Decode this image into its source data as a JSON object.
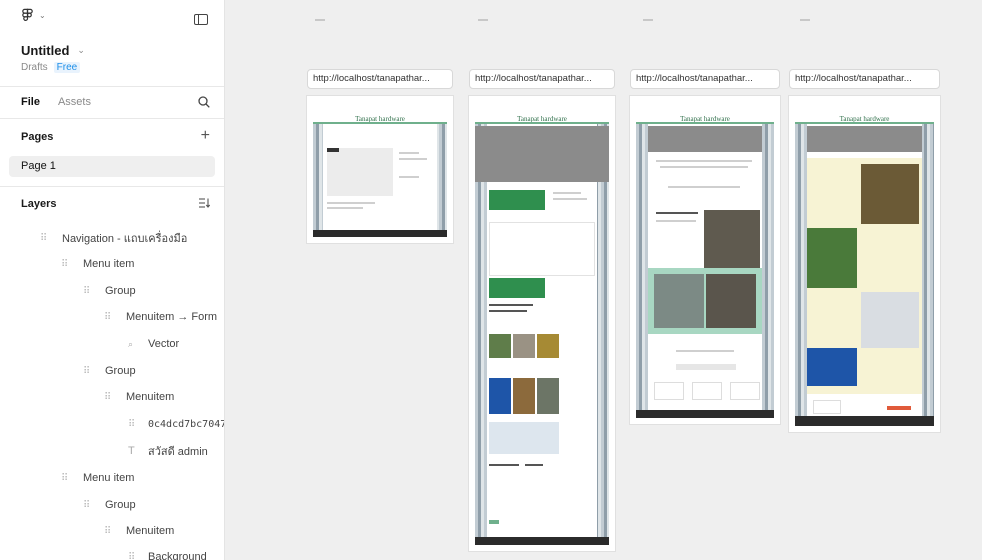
{
  "sidebar": {
    "file_name": "Untitled",
    "location": "Drafts",
    "plan_badge": "Free",
    "tabs": {
      "file": "File",
      "assets": "Assets"
    },
    "pages_title": "Pages",
    "pages": [
      "Page 1"
    ],
    "layers_title": "Layers",
    "layers": [
      {
        "label": "Navigation - แถบเครื่องมือ",
        "kind": "grid"
      },
      {
        "label": "Menu item",
        "kind": "grid"
      },
      {
        "label": "Group",
        "kind": "grid"
      },
      {
        "label": "Menuitem → Form",
        "kind": "grid"
      },
      {
        "label": "Vector",
        "kind": "vector"
      },
      {
        "label": "Group",
        "kind": "grid"
      },
      {
        "label": "Menuitem",
        "kind": "grid"
      },
      {
        "label": "0c4dcd7bc7047",
        "kind": "grid"
      },
      {
        "label": "สวัสดี admin",
        "kind": "text"
      },
      {
        "label": "Menu item",
        "kind": "grid"
      },
      {
        "label": "Group",
        "kind": "grid"
      },
      {
        "label": "Menuitem",
        "kind": "grid"
      },
      {
        "label": "Background",
        "kind": "grid"
      }
    ]
  },
  "canvas": {
    "frame_label": "http://localhost/tanapathar...",
    "site_title": "Tanapat hardware",
    "frames": [
      {
        "label": "http://localhost/tanapathar..."
      },
      {
        "label": "http://localhost/tanapathar..."
      },
      {
        "label": "http://localhost/tanapathar..."
      },
      {
        "label": "http://localhost/tanapathar..."
      }
    ]
  },
  "icons": {
    "logo": "figma-logo-icon",
    "panel": "sidebar-toggle-icon",
    "search": "search-icon",
    "add_page": "plus-icon",
    "layers_menu": "layers-sort-icon"
  },
  "colors": {
    "accent_blue": "#1d8fe8",
    "site_green": "#2f8f4e",
    "canvas_bg": "#efefef"
  }
}
